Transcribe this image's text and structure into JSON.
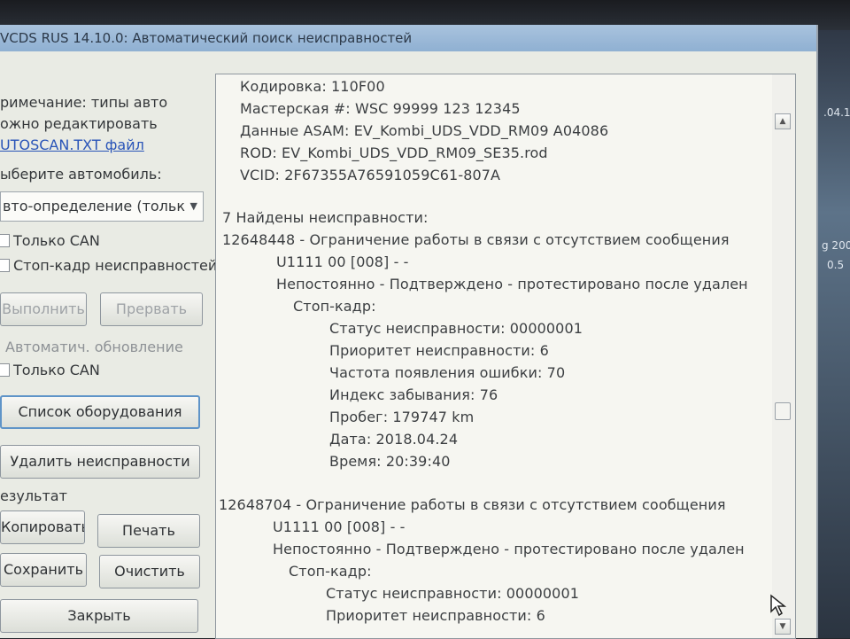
{
  "window": {
    "title": "VCDS RUS 14.10.0:  Автоматический поиск неисправностей"
  },
  "left_panel": {
    "note_line1": "римечание: типы авто",
    "note_line2": "ожно редактировать",
    "note_link": "UTOSCAN.TXT файл",
    "select_label": "ыберите автомобиль:",
    "combo_value": "вто-определение (тольк",
    "check_can": "Только CAN",
    "check_freeze": "Стоп-кадр неисправностей",
    "btn_run": "Выполнить",
    "btn_abort": "Прервать",
    "auto_update_label": "Автоматич. обновление",
    "check_can2": "Только CAN",
    "btn_equipment": "Список оборудования",
    "btn_delete": "Удалить неисправности",
    "result_label": "езультат",
    "btn_copy": "Копировать",
    "btn_print": "Печать",
    "btn_save": "Сохранить",
    "btn_clear": "Очистить",
    "btn_close": "Закрыть"
  },
  "output": {
    "lines": [
      "Кодировка: 110F00",
      "Мастерская #: WSC 99999 123 12345",
      "Данные ASAM: EV_Kombi_UDS_VDD_RM09 A04086",
      "ROD: EV_Kombi_UDS_VDD_RM09_SE35.rod",
      "VCID: 2F67355A76591059C61-807A",
      "7 Найдены неисправности:",
      "12648448 - Ограничение работы в связи с отсутствием сообщения",
      "U1111 00 [008] - -",
      "Непостоянно - Подтверждено - протестировано после удален",
      "Стоп-кадр:",
      "Статус неисправности: 00000001",
      "Приоритет неисправности: 6",
      "Частота появления ошибки: 70",
      "Индекс забывания: 76",
      "Пробег: 179747 km",
      "Дата: 2018.04.24",
      "Время: 20:39:40",
      "12648704 - Ограничение работы в связи с отсутствием сообщения",
      "U1111 00 [008] - -",
      "Непостоянно - Подтверждено - протестировано после удален",
      "Стоп-кадр:",
      "Статус неисправности: 00000001",
      "Приоритет неисправности: 6"
    ]
  },
  "desktop": {
    "text1": ".04.1",
    "text2": "g 200",
    "text3": "0.5"
  }
}
